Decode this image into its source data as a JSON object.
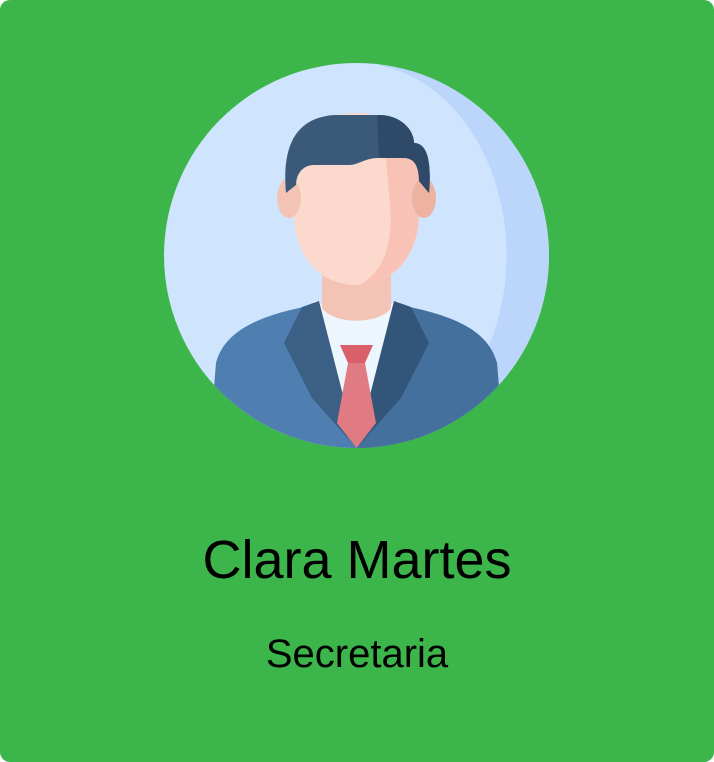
{
  "profile": {
    "name": "Clara Martes",
    "role": "Secretaria",
    "avatar_icon": "businessman-avatar-icon"
  },
  "colors": {
    "card_background": "#3cb54a",
    "avatar_circle": "#cfe4fd",
    "avatar_circle_shade": "#bcd6fb",
    "hair": "#3b5a7a",
    "skin": "#fcd9cd",
    "suit": "#4f7fb0",
    "tie": "#e07b83",
    "text": "#000000"
  }
}
